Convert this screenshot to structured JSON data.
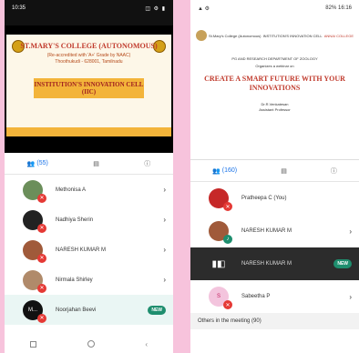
{
  "left": {
    "status": {
      "time": "10:35",
      "icons": "◫ ⚙ ▮"
    },
    "slide": {
      "college": "ST.MARY'S COLLEGE (AUTONOMOUS)",
      "accreditation": "(Re-accredited with 'A+' Grade by NAAC)",
      "place": "Thoothukudi - 628001, Tamilnadu",
      "title": "INSTITUTION'S INNOVATION CELL (IIC)"
    },
    "tabs": {
      "participants": "(55)"
    },
    "participants": [
      {
        "name": "Methonisa A",
        "initials": ""
      },
      {
        "name": "Nadhiya Sherin",
        "initials": ""
      },
      {
        "name": "NARESH KUMAR M",
        "initials": ""
      },
      {
        "name": "Nirmala Shirley",
        "initials": ""
      },
      {
        "name": "Noorjahan Beevi",
        "initials": "M...",
        "badge": "NEW"
      }
    ]
  },
  "right": {
    "status": {
      "time": "16:16",
      "battery": "82%"
    },
    "slide": {
      "college_left": "St.Mary's College (Autonomous)",
      "center_org": "INSTITUTION'S INNOVATION CELL",
      "right_org": "ANNAI COLLEGE",
      "dept": "PG AND RESEARCH DEPARTMENT OF ZOOLOGY",
      "organizes": "Organizes a webinar on",
      "title": "CREATE A SMART FUTURE WITH YOUR INNOVATIONS",
      "speaker": "Dr.R.Venkatesan",
      "speaker_role": "Assistant Professor"
    },
    "tabs": {
      "participants": "(160)"
    },
    "participants": [
      {
        "name": "Pratheepa C (You)"
      },
      {
        "name": "NARESH KUMAR M"
      },
      {
        "name": "NARESH KUMAR M",
        "badge": "NEW"
      },
      {
        "name": "Sabeetha P",
        "initials": "S"
      }
    ],
    "others_label": "Others in the meeting (90)"
  }
}
